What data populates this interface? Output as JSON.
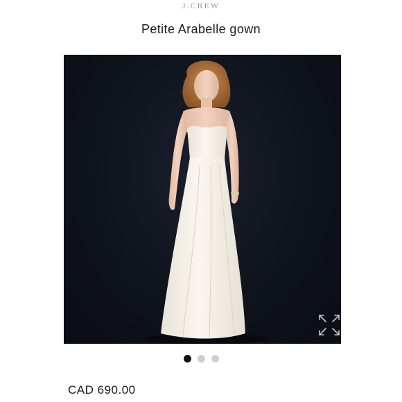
{
  "header": {
    "brand": "J.CREW",
    "title": "Petite Arabelle gown"
  },
  "gallery": {
    "image_count": 3,
    "active_index": 0,
    "expand_icon": "expand-arrows-icon"
  },
  "price": {
    "text": "CAD 690.00"
  },
  "colors": {
    "backdrop": "#0f131c",
    "gown": "#f7f2ea",
    "active_dot": "#111111",
    "inactive_dot": "#cfcfcf"
  }
}
